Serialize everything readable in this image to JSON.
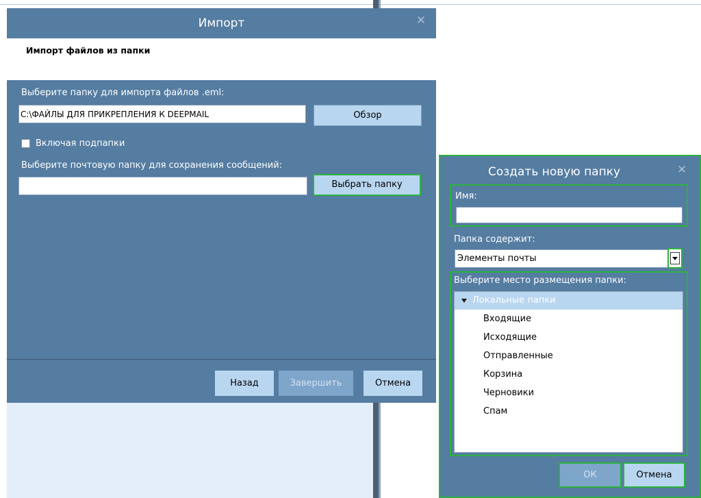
{
  "import_dialog": {
    "title": "Импорт",
    "header": "Импорт файлов из папки",
    "folder_label": "Выберите папку для импорта файлов .eml:",
    "folder_value": "C:\\ФАЙЛЫ ДЛЯ ПРИКРЕПЛЕНИЯ К DEEPMAIL",
    "browse_label": "Обзор",
    "include_subfolders_label": "Включая подпапки",
    "include_subfolders_checked": false,
    "mail_folder_label": "Выберите почтовую папку для сохранения сообщений:",
    "mail_folder_value": "",
    "select_folder_label": "Выбрать папку",
    "back_label": "Назад",
    "finish_label": "Завершить",
    "cancel_label": "Отмена"
  },
  "create_dialog": {
    "title": "Создать новую папку",
    "name_label": "Имя:",
    "name_value": "",
    "contains_label": "Папка содержит:",
    "contains_value": "Элементы почты",
    "location_label": "Выберите место размещения папки:",
    "tree_root": "Локальные папки",
    "tree_items": [
      "Входящие",
      "Исходящие",
      "Отправленные",
      "Корзина",
      "Черновики",
      "Спам"
    ],
    "ok_label": "ОК",
    "cancel_label": "Отмена"
  },
  "icons": {
    "close": "close-icon",
    "dropdown": "chevron-down-icon",
    "expand": "triangle-down-icon"
  },
  "colors": {
    "dialog_bg": "#557ca1",
    "button_bg": "#b9d6f0",
    "highlight": "#2bb33d"
  }
}
